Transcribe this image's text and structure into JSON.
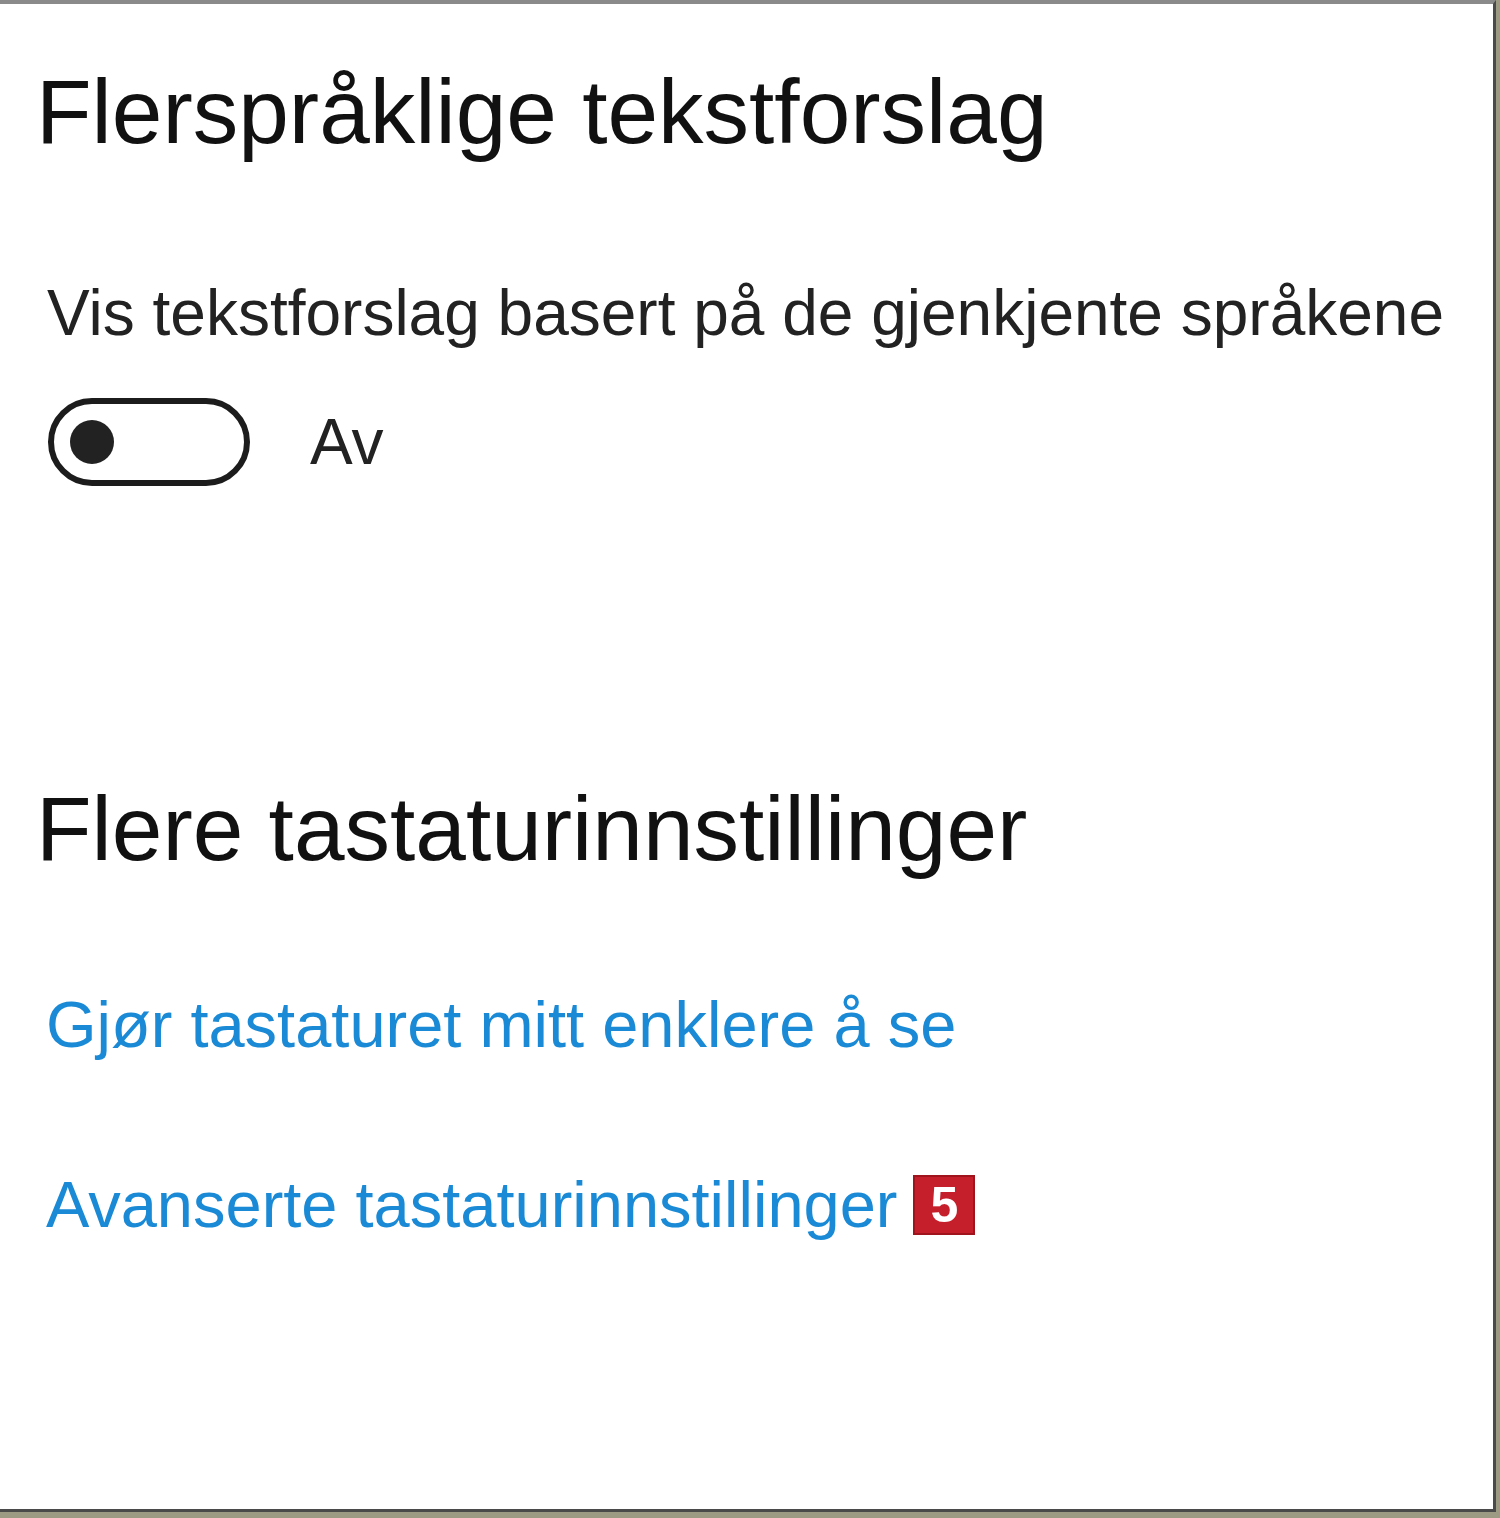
{
  "sections": [
    {
      "kind": "toggle",
      "heading": "Flerspråklige tekstforslag",
      "description": "Vis tekstforslag basert på de gjenkjente språkene",
      "toggle": {
        "on": false,
        "label": "Av"
      }
    },
    {
      "kind": "links",
      "heading": "Flere tastaturinnstillinger",
      "links": [
        {
          "text": "Gjør tastaturet mitt enklere å se"
        },
        {
          "text": "Avanserte tastaturinnstillinger",
          "badge": "5"
        }
      ]
    }
  ]
}
